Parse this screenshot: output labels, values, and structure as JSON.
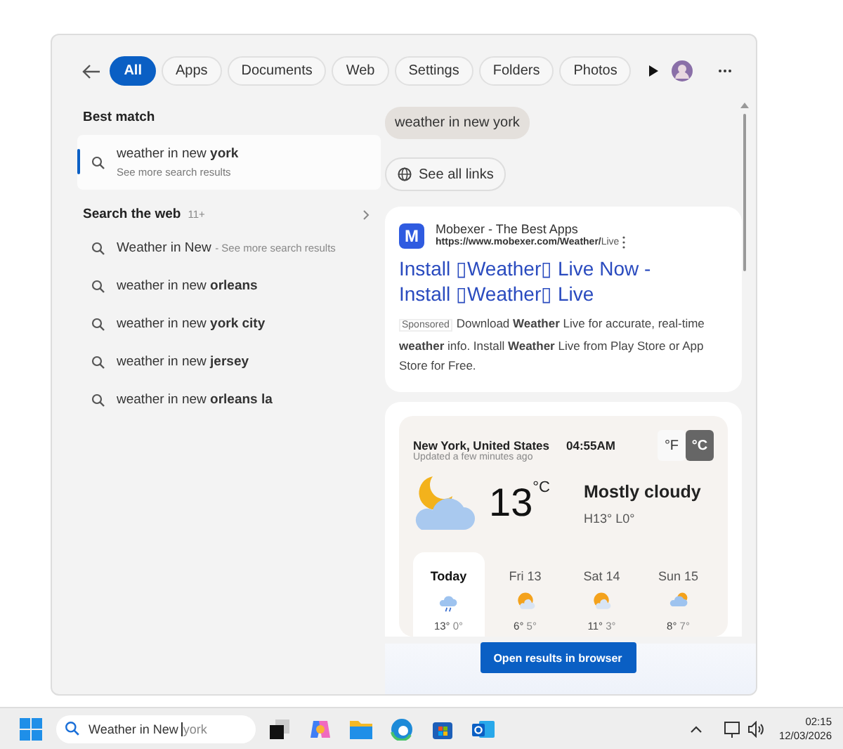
{
  "filters": [
    {
      "label": "All",
      "selected": true
    },
    {
      "label": "Apps",
      "selected": false
    },
    {
      "label": "Documents",
      "selected": false
    },
    {
      "label": "Web",
      "selected": false
    },
    {
      "label": "Settings",
      "selected": false
    },
    {
      "label": "Folders",
      "selected": false
    },
    {
      "label": "Photos",
      "selected": false
    }
  ],
  "best_match": {
    "heading": "Best match",
    "title": "weather in new **york**",
    "subtitle": "See more search results",
    "selected": true
  },
  "search_web": {
    "heading": "Search the web",
    "count": "11+",
    "items": [
      {
        "text": "Weather in New",
        "hint": "- See more search results"
      },
      {
        "text": "weather in new **orleans**"
      },
      {
        "text": "weather in new **york city**"
      },
      {
        "text": "weather in new **jersey**"
      },
      {
        "text": "weather in new **orleans la**"
      }
    ]
  },
  "query_chip": "weather in new york",
  "see_all_links": "See all links",
  "ad": {
    "logo": "M",
    "site": "Mobexer - The Best Apps",
    "url": "https://www.mobexer.com/Weather/",
    "url_tail": "Live",
    "title": "Install ▯Weather▯ Live Now - Install ▯Weather▯ Live",
    "sponsored": "Sponsored",
    "description": "Download **Weather** Live for accurate, real-time **weather** info. Install **Weather** Live from Play Store or App Store for Free."
  },
  "weather": {
    "location": "New York, United States",
    "time": "04:55AM",
    "updated": "Updated a few minutes ago",
    "units": [
      {
        "label": "°F",
        "selected": false
      },
      {
        "label": "°C",
        "selected": true
      }
    ],
    "temperature": "13",
    "unit": "°C",
    "condition": "Mostly cloudy",
    "high_low": "H13° L0°",
    "forecast": [
      {
        "day": "Today",
        "kind": "rain",
        "high": "13°",
        "low": "0°",
        "selected": true
      },
      {
        "day": "Fri 13",
        "kind": "sun",
        "high": "6°",
        "low": "5°",
        "selected": false
      },
      {
        "day": "Sat 14",
        "kind": "sun",
        "high": "11°",
        "low": "3°",
        "selected": false
      },
      {
        "day": "Sun 15",
        "kind": "cloud",
        "high": "8°",
        "low": "7°",
        "selected": false
      }
    ]
  },
  "open_button": "Open results in browser",
  "taskbar": {
    "search_value": "Weather in New ",
    "search_suggestion": "york",
    "time": "02:15",
    "date": "12/03/2026"
  }
}
